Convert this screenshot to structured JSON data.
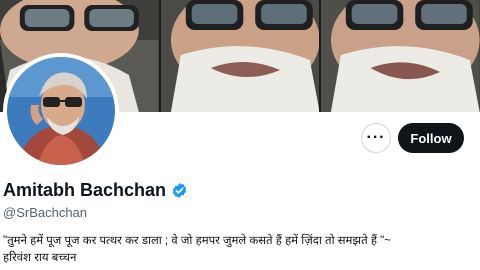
{
  "profile": {
    "display_name": "Amitabh Bachchan",
    "handle": "@SrBachchan",
    "bio_line1": "\"तुमने हमें पूज पूज कर पत्थर कर डाला ; वे जो हमपर जुमले कसते हैं हमें ज़िंदा तो समझते हैं \"~",
    "bio_line2": "हरिवंश राय बच्चन"
  },
  "actions": {
    "more_label": "···",
    "follow_label": "Follow"
  },
  "colors": {
    "follow_bg": "#0f1419",
    "verified": "#1d9bf0",
    "handle_gray": "#536471"
  },
  "icons": {
    "verified": "verified-badge-icon",
    "more": "more-options-icon"
  }
}
